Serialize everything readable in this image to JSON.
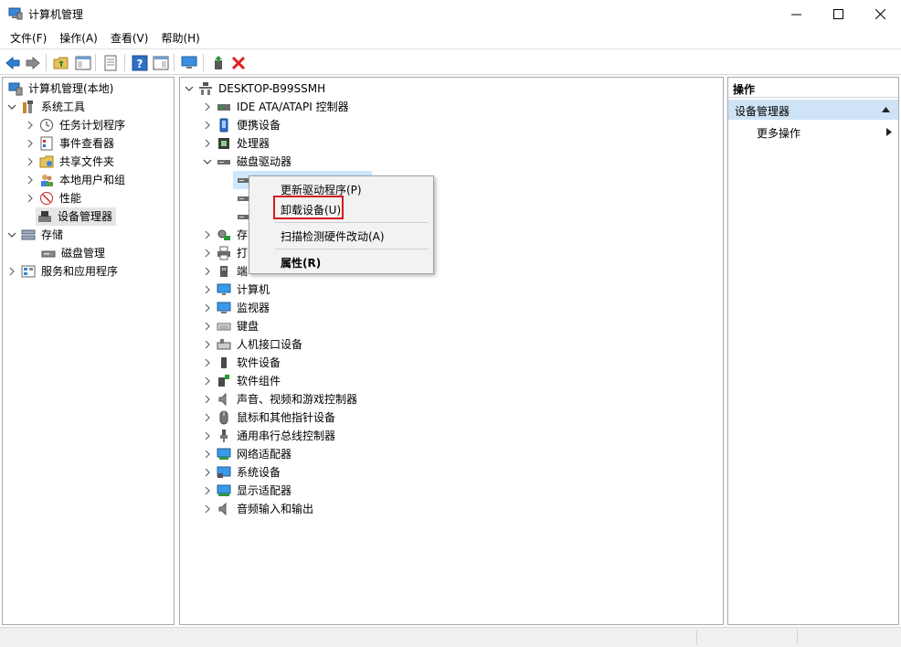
{
  "window": {
    "title": "计算机管理",
    "controls": {
      "minimize": "minimize-icon",
      "maximize": "maximize-icon",
      "close": "close-icon"
    }
  },
  "menubar": [
    "文件(F)",
    "操作(A)",
    "查看(V)",
    "帮助(H)"
  ],
  "toolbar": [
    "back-arrow-icon",
    "forward-arrow-icon",
    "up-folder-icon",
    "show-hide-tree-icon",
    "properties-sheet-icon",
    "help-icon",
    "action-pane-icon",
    "monitor-icon",
    "update-driver-icon",
    "uninstall-x-icon"
  ],
  "left_tree": {
    "root": "计算机管理(本地)",
    "system_tools": "系统工具",
    "task_scheduler": "任务计划程序",
    "event_viewer": "事件查看器",
    "shared_folders": "共享文件夹",
    "local_users": "本地用户和组",
    "performance": "性能",
    "device_manager": "设备管理器",
    "storage": "存储",
    "disk_management": "磁盘管理",
    "services": "服务和应用程序"
  },
  "device_tree": {
    "computer_name": "DESKTOP-B99SSMH",
    "ide": "IDE ATA/ATAPI 控制器",
    "portable": "便携设备",
    "processor": "处理器",
    "disk_drives": "磁盘驱动器",
    "storage_partial": "存",
    "print_partial": "打",
    "ports_partial": "端",
    "computer": "计算机",
    "monitors": "监视器",
    "keyboard": "键盘",
    "hid": "人机接口设备",
    "software_devices": "软件设备",
    "software_components": "软件组件",
    "audio_video": "声音、视频和游戏控制器",
    "mouse": "鼠标和其他指针设备",
    "usb": "通用串行总线控制器",
    "network": "网络适配器",
    "system_devices": "系统设备",
    "display": "显示适配器",
    "audio_io": "音频输入和输出"
  },
  "context_menu": {
    "update_driver": "更新驱动程序(P)",
    "uninstall": "卸载设备(U)",
    "scan": "扫描检测硬件改动(A)",
    "properties": "属性(R)"
  },
  "actions_pane": {
    "header": "操作",
    "section": "设备管理器",
    "more": "更多操作"
  },
  "colors": {
    "selection_blue": "#cfe3f6",
    "highlight_red": "#d7191c",
    "uninstall_red": "#e02020"
  }
}
